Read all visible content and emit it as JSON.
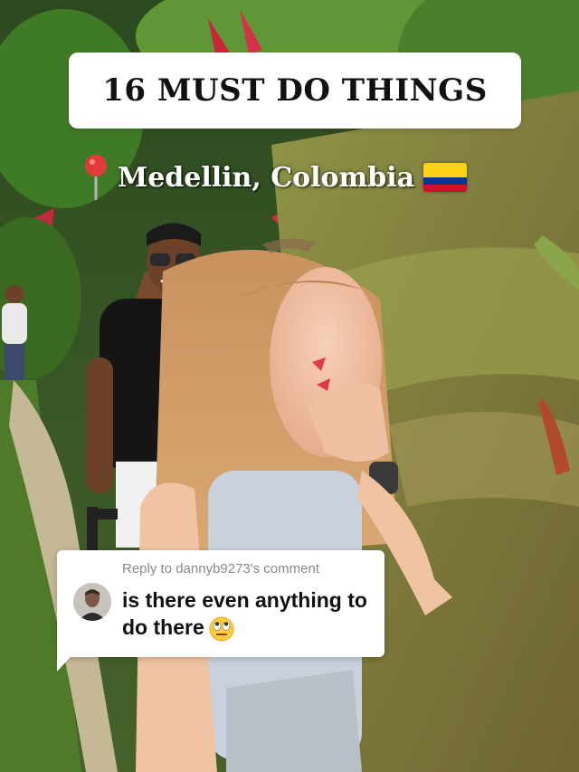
{
  "title": "16 MUST DO THINGS",
  "location": "Medellin, Colombia",
  "flag": "colombia-flag-icon",
  "pin": "round-pushpin-icon",
  "comment": {
    "reply_to": "Reply to dannyb9273's comment",
    "text": "is there even anything to do there",
    "emoji": "rolling-eyes-emoji"
  },
  "colors": {
    "foliage_dark": "#2f5a1f",
    "grass": "#7f8d3a",
    "path": "#b9ad8e",
    "flag_yellow": "#FCD116",
    "flag_blue": "#003893",
    "flag_red": "#CE1126"
  }
}
